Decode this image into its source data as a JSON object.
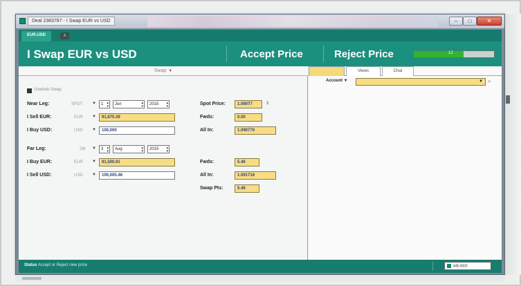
{
  "window": {
    "title": "Deal 2383787 - I Swap EUR vs USD",
    "min_glyph": "–",
    "max_glyph": "□",
    "close_glyph": "✕"
  },
  "tab": {
    "label": "EUR.USD",
    "close_glyph": "x"
  },
  "header": {
    "title": "I Swap EUR vs USD",
    "accept": "Accept Price",
    "reject": "Reject Price",
    "timer_value": "12",
    "timer_progress": 0.62
  },
  "swap": {
    "header": "Swap",
    "arrow": "▼",
    "checkbox_label": "Unwinds Swap"
  },
  "near_leg": {
    "label": "Near Leg:",
    "tenor": "SPOT",
    "day": "1",
    "month": "Jun",
    "year": "2015",
    "sell_label": "I Sell EUR:",
    "sell_currency": "EUR",
    "sell_value": "91,675.39",
    "buy_label": "I Buy USD:",
    "buy_currency": "USD",
    "buy_value": "100,000",
    "spot_label": "Spot Price:",
    "spot_value": "1.09077",
    "spot_icon": "$",
    "fwds_label": "Fwds:",
    "fwds_value": "0.00",
    "allin_label": "All In:",
    "allin_value": "1.090770"
  },
  "far_leg": {
    "label": "Far Leg:",
    "tenor": "2M",
    "day": "3",
    "month": "Aug",
    "year": "2015",
    "buy_label": "I Buy EUR:",
    "buy_currency": "EUR",
    "buy_value": "91,500.91",
    "sell_label": "I Sell USD:",
    "sell_currency": "USD",
    "sell_value": "100,005.46",
    "fwds_label": "Fwds:",
    "fwds_value": "5.46",
    "allin_label": "All In:",
    "allin_value": "1.091716",
    "swap_pts_label": "Swap Pts:",
    "swap_pts_value": "5.46"
  },
  "dropdown_arrow": "▼",
  "right": {
    "tabs": [
      "",
      "Views",
      "Chat"
    ],
    "account_label": "Account",
    "account_value": "",
    "search_icon": "⌕"
  },
  "status": {
    "label": "Status",
    "text": "Accept or Reject new price",
    "box_text": "AIB.0000"
  },
  "colors": {
    "teal_header": "#1b907e",
    "yellow_field": "#f7de84",
    "timer_green": "#34b234"
  }
}
